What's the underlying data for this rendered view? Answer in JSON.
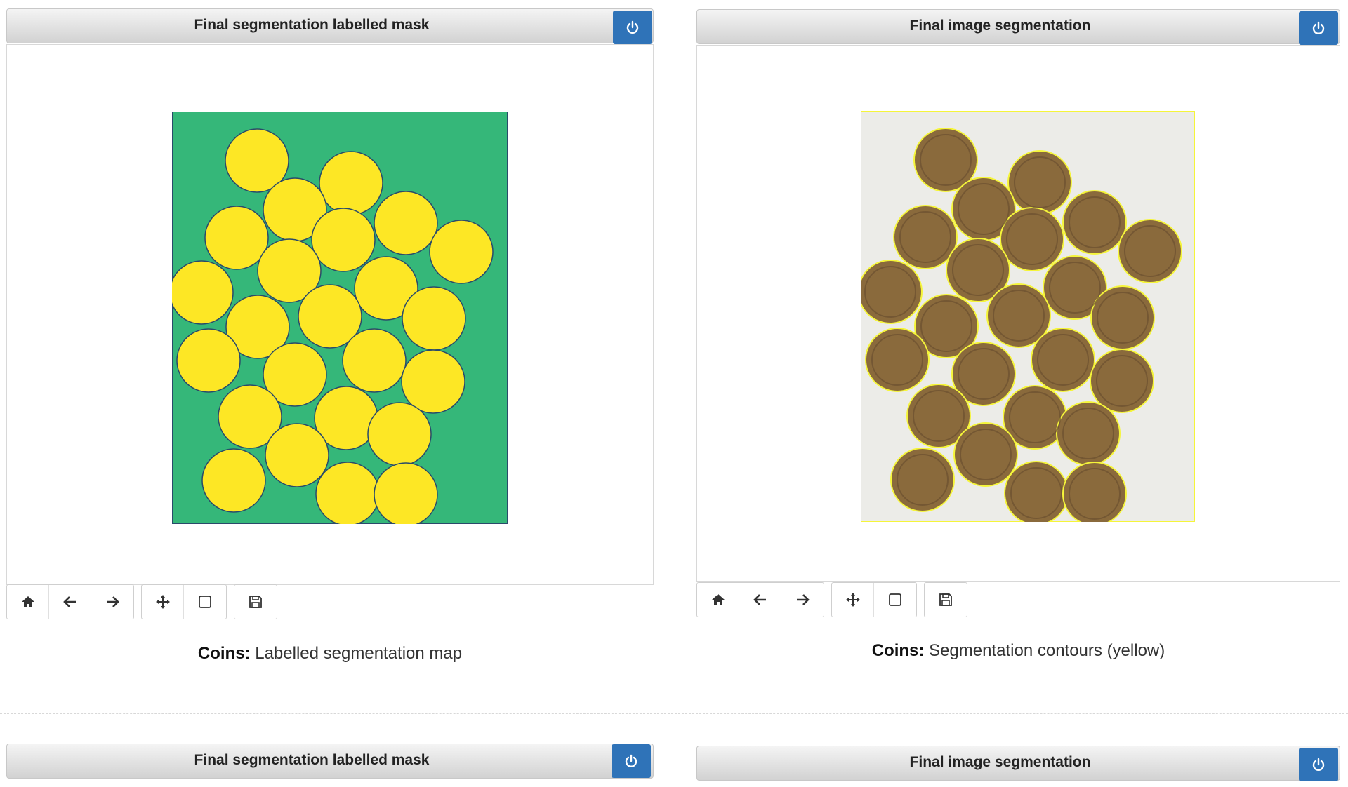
{
  "top_left": {
    "title": "Final segmentation labelled mask",
    "caption_bold": "Coins:",
    "caption_text": "Labelled segmentation map"
  },
  "top_right": {
    "title": "Final image segmentation",
    "caption_bold": "Coins:",
    "caption_text": "Segmentation contours (yellow)"
  },
  "bottom_left": {
    "title": "Final segmentation labelled mask"
  },
  "bottom_right": {
    "title": "Final image segmentation"
  },
  "toolbar_icons": [
    "home-icon",
    "back-arrow-icon",
    "forward-arrow-icon",
    "pan-icon",
    "zoom-rect-icon",
    "save-icon"
  ],
  "colors": {
    "mask_background": "#35b779",
    "mask_foreground": "#fde725",
    "contour": "#f5f53a",
    "coin": "#8a6a3c",
    "power_button": "#2f73b8"
  }
}
